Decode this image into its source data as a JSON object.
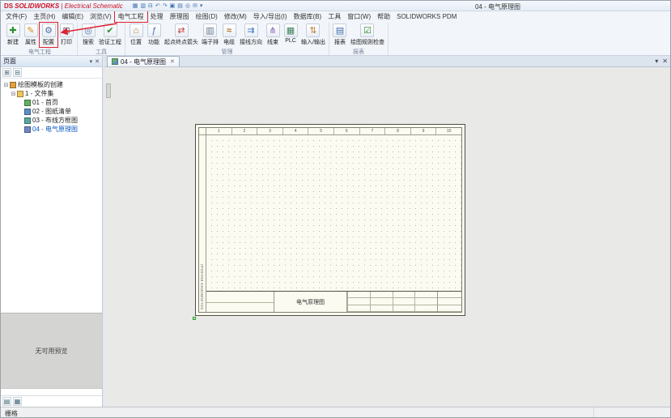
{
  "titlebar": {
    "logo": "DS",
    "brand": "SOLIDWORKS",
    "brand_suffix": "| Electrical Schematic",
    "doc_title": "04 - 电气原理图",
    "quick_icons": [
      {
        "name": "save-icon",
        "glyph": "▦"
      },
      {
        "name": "save-all-icon",
        "glyph": "▥"
      },
      {
        "name": "print-icon",
        "glyph": "⊟"
      },
      {
        "name": "undo-icon",
        "glyph": "↶"
      },
      {
        "name": "redo-icon",
        "glyph": "↷"
      },
      {
        "name": "copy-icon",
        "glyph": "▣"
      },
      {
        "name": "paste-icon",
        "glyph": "▤"
      },
      {
        "name": "zoom-icon",
        "glyph": "◎"
      },
      {
        "name": "mail-icon",
        "glyph": "✉"
      },
      {
        "name": "more-icon",
        "glyph": "▾"
      }
    ]
  },
  "menubar": {
    "items": [
      {
        "label": "文件(F)"
      },
      {
        "label": "主页(H)"
      },
      {
        "label": "编辑(E)"
      },
      {
        "label": "浏览(V)"
      },
      {
        "label": "电气工程",
        "annotated": true
      },
      {
        "label": "处理"
      },
      {
        "label": "原理图"
      },
      {
        "label": "绘图(D)"
      },
      {
        "label": "修改(M)"
      },
      {
        "label": "导入/导出(I)"
      },
      {
        "label": "数据库(B)"
      },
      {
        "label": "工具"
      },
      {
        "label": "窗口(W)"
      },
      {
        "label": "帮助"
      },
      {
        "label": "SOLIDWORKS PDM"
      }
    ]
  },
  "ribbon": {
    "groups": [
      {
        "label": "电气工程",
        "buttons": [
          {
            "label": "新建",
            "icon": "new",
            "glyph": "✚"
          },
          {
            "label": "属性",
            "icon": "properties",
            "glyph": "✎"
          },
          {
            "label": "配置",
            "icon": "config",
            "glyph": "⚙",
            "annotated": true
          },
          {
            "label": "打印",
            "icon": "print",
            "glyph": "⊟"
          }
        ]
      },
      {
        "label": "工具",
        "buttons": [
          {
            "label": "搜索",
            "icon": "search",
            "glyph": "◎"
          },
          {
            "label": "验证工程",
            "icon": "verify",
            "glyph": "✔"
          }
        ]
      },
      {
        "label": "管理",
        "buttons": [
          {
            "label": "位置",
            "icon": "location",
            "glyph": "⌂"
          },
          {
            "label": "功能",
            "icon": "function",
            "glyph": "ƒ"
          },
          {
            "label": "起点终点箭头",
            "icon": "arrows",
            "glyph": "⇄"
          },
          {
            "label": "端子排",
            "icon": "terminal-strip",
            "glyph": "▥"
          },
          {
            "label": "电缆",
            "icon": "cable",
            "glyph": "≈"
          },
          {
            "label": "接线方向",
            "icon": "wire-direction",
            "glyph": "⇉"
          },
          {
            "label": "线束",
            "icon": "harness",
            "glyph": "⋔"
          },
          {
            "label": "PLC",
            "icon": "plc",
            "glyph": "▦"
          },
          {
            "label": "输入/输出",
            "icon": "io",
            "glyph": "⇅"
          }
        ]
      },
      {
        "label": "报表",
        "buttons": [
          {
            "label": "报表",
            "icon": "report",
            "glyph": "▤"
          },
          {
            "label": "绘图规则检查",
            "icon": "drc",
            "glyph": "☑"
          }
        ]
      }
    ]
  },
  "pages_panel": {
    "title": "页面",
    "header_icons": [
      {
        "name": "panel-menu-icon",
        "glyph": "▾"
      },
      {
        "name": "panel-close-icon",
        "glyph": "✕"
      }
    ],
    "toolbar_icons": [
      {
        "name": "expand-all-icon",
        "glyph": "⊞"
      },
      {
        "name": "collapse-all-icon",
        "glyph": "⊟"
      }
    ],
    "tree": [
      {
        "label": "绘图模板的创建",
        "level": 0,
        "icon": "project",
        "expander": "⊟"
      },
      {
        "label": "1 - 文件集",
        "level": 1,
        "icon": "fileset",
        "expander": "⊟"
      },
      {
        "label": "01 - 首页",
        "level": 2,
        "icon": "page-cover"
      },
      {
        "label": "02 - 图纸清单",
        "level": 2,
        "icon": "page-list"
      },
      {
        "label": "03 - 布线方框图",
        "level": 2,
        "icon": "page-wiring"
      },
      {
        "label": "04 - 电气原理图",
        "level": 2,
        "icon": "page-schematic",
        "selected": true
      }
    ],
    "preview_text": "无可用预览",
    "footer_icons": [
      {
        "name": "pages-view-icon",
        "glyph": "▤"
      },
      {
        "name": "preview-toggle-icon",
        "glyph": "▦"
      }
    ]
  },
  "main": {
    "tab": {
      "label": "04 - 电气原理图",
      "close_glyph": "✕"
    },
    "tabbar_controls": [
      {
        "name": "tab-list-dropdown-icon",
        "glyph": "▾"
      },
      {
        "name": "close-document-icon",
        "glyph": "✕"
      }
    ]
  },
  "sheet": {
    "columns": [
      "1",
      "2",
      "3",
      "4",
      "5",
      "6",
      "7",
      "8",
      "9",
      "10"
    ],
    "side_label": "SOLIDWORKS Electrical",
    "title_block": {
      "title": "电气原理图"
    }
  },
  "statusbar": {
    "left": "栅格"
  }
}
